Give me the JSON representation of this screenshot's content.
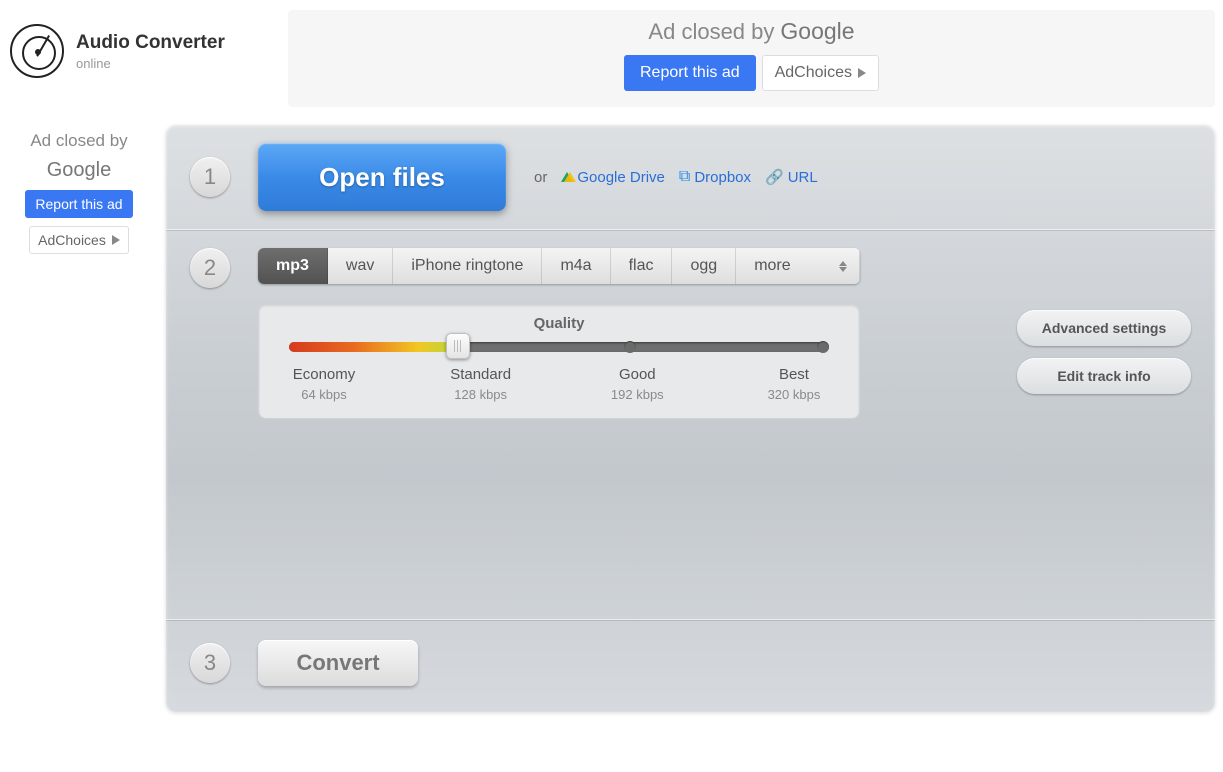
{
  "header": {
    "title": "Audio Converter",
    "subtitle": "online"
  },
  "ad_top": {
    "closed_text": "Ad closed by",
    "google": "Google",
    "report": "Report this ad",
    "adchoices": "AdChoices"
  },
  "ad_left": {
    "closed_text": "Ad closed by",
    "google": "Google",
    "report": "Report this ad",
    "adchoices": "AdChoices"
  },
  "steps": {
    "one": "1",
    "two": "2",
    "three": "3"
  },
  "step1": {
    "open": "Open files",
    "or": "or",
    "drive": "Google Drive",
    "dropbox": "Dropbox",
    "url": "URL"
  },
  "formats": [
    "mp3",
    "wav",
    "iPhone ringtone",
    "m4a",
    "flac",
    "ogg",
    "more"
  ],
  "quality": {
    "title": "Quality",
    "levels": [
      {
        "label": "Economy",
        "kbps": "64 kbps"
      },
      {
        "label": "Standard",
        "kbps": "128 kbps"
      },
      {
        "label": "Good",
        "kbps": "192 kbps"
      },
      {
        "label": "Best",
        "kbps": "320 kbps"
      }
    ]
  },
  "side": {
    "advanced": "Advanced settings",
    "trackinfo": "Edit track info"
  },
  "convert": "Convert"
}
